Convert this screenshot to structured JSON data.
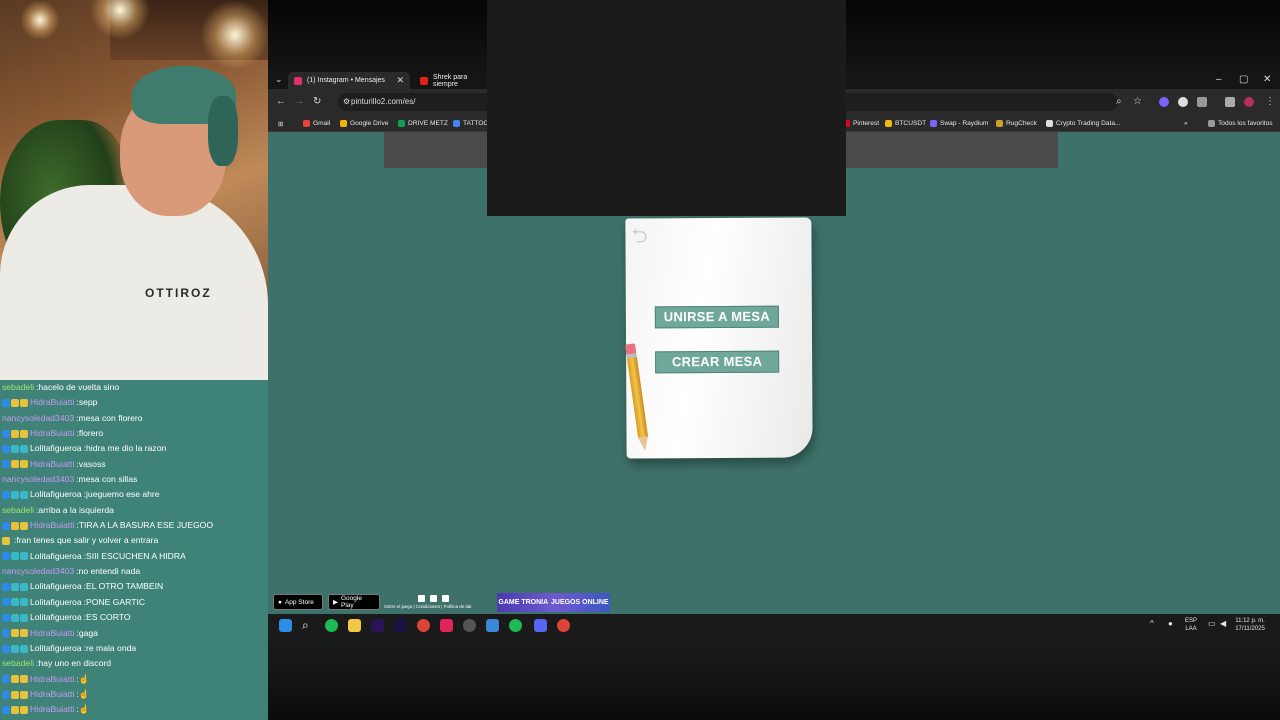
{
  "webcam": {
    "shirt_text": "OTTIROZ"
  },
  "chat": {
    "lines": [
      {
        "user": "sebadeli",
        "msg": "hacelo de vuelta sino",
        "color": "#9bea6e",
        "badges": []
      },
      {
        "user": "HidraBuiatti",
        "msg": "sepp",
        "color": "#c79af4",
        "badges": [
          "b-blue",
          "b-yellow",
          "b-yellow"
        ]
      },
      {
        "user": "nancysoledad3403",
        "msg": "mesa con florero",
        "color": "#c79af4",
        "badges": []
      },
      {
        "user": "HidraBuiatti",
        "msg": "florero",
        "color": "#c79af4",
        "badges": [
          "b-blue",
          "b-yellow",
          "b-yellow"
        ]
      },
      {
        "user": "Lolitafigueroa",
        "msg": "hidra me dio la razon",
        "color": "#ffffff",
        "badges": [
          "b-blue",
          "b-teal",
          "b-teal"
        ]
      },
      {
        "user": "HidraBuiatti",
        "msg": "vasoss",
        "color": "#c79af4",
        "badges": [
          "b-blue",
          "b-yellow",
          "b-yellow"
        ]
      },
      {
        "user": "nancysoledad3403",
        "msg": "mesa con sillas",
        "color": "#c79af4",
        "badges": []
      },
      {
        "user": "Lolitafigueroa",
        "msg": "jueguemo ese ahre",
        "color": "#ffffff",
        "badges": [
          "b-blue",
          "b-teal",
          "b-teal"
        ]
      },
      {
        "user": "sebadeli",
        "msg": "arriba a la isquierda",
        "color": "#9bea6e",
        "badges": []
      },
      {
        "user": "HidraBuiatti",
        "msg": "TIRA A LA BASURA ESE JUEGOO",
        "color": "#c79af4",
        "badges": [
          "b-blue",
          "b-yellow",
          "b-yellow"
        ]
      },
      {
        "user": "",
        "msg": "fran tenes que salir y volver a entrara",
        "color": "#c0392b",
        "badges": [
          "b-yellow"
        ]
      },
      {
        "user": "Lolitafigueroa",
        "msg": "SIII ESCUCHEN A HIDRA",
        "color": "#ffffff",
        "badges": [
          "b-blue",
          "b-teal",
          "b-teal"
        ]
      },
      {
        "user": "nancysoledad3403",
        "msg": "no entendi nada",
        "color": "#c79af4",
        "badges": []
      },
      {
        "user": "Lolitafigueroa",
        "msg": "EL OTRO TAMBEIN",
        "color": "#ffffff",
        "badges": [
          "b-blue",
          "b-teal",
          "b-teal"
        ]
      },
      {
        "user": "Lolitafigueroa",
        "msg": "PONE GARTIC",
        "color": "#ffffff",
        "badges": [
          "b-blue",
          "b-teal",
          "b-teal"
        ]
      },
      {
        "user": "Lolitafigueroa",
        "msg": "ES CORTO",
        "color": "#ffffff",
        "badges": [
          "b-blue",
          "b-teal",
          "b-teal"
        ]
      },
      {
        "user": "HidraBuiatti",
        "msg": "gaga",
        "color": "#c79af4",
        "badges": [
          "b-blue",
          "b-yellow",
          "b-yellow"
        ]
      },
      {
        "user": "Lolitafigueroa",
        "msg": "re mala onda",
        "color": "#ffffff",
        "badges": [
          "b-blue",
          "b-teal",
          "b-teal"
        ]
      },
      {
        "user": "sebadeli",
        "msg": "hay uno en discord",
        "color": "#9bea6e",
        "badges": []
      },
      {
        "user": "HidraBuiatti",
        "msg": "☝",
        "color": "#c79af4",
        "badges": [
          "b-blue",
          "b-yellow",
          "b-yellow"
        ]
      },
      {
        "user": "HidraBuiatti",
        "msg": "☝",
        "color": "#c79af4",
        "badges": [
          "b-blue",
          "b-yellow",
          "b-yellow"
        ]
      },
      {
        "user": "HidraBuiatti",
        "msg": "☝",
        "color": "#c79af4",
        "badges": [
          "b-blue",
          "b-yellow",
          "b-yellow"
        ]
      }
    ]
  },
  "browser": {
    "tabs": [
      {
        "label": "(1) Instagram • Mensajes",
        "fav_color": "#e1306c"
      },
      {
        "label": "Shrek para siempre",
        "fav_color": "#e62117"
      }
    ],
    "url": "pinturillo2.com/es/",
    "bookmarks": [
      {
        "label": "Gmail",
        "color": "#ea4335"
      },
      {
        "label": "Google Drive",
        "color": "#f4b400"
      },
      {
        "label": "DRIVE METZ",
        "color": "#0f9d58"
      },
      {
        "label": "TATTOO",
        "color": "#4285f4"
      },
      {
        "label": "Pinterest",
        "color": "#e60023"
      },
      {
        "label": "BTCUSDT",
        "color": "#f0b90b"
      },
      {
        "label": "Swap - Raydium",
        "color": "#7b61ff"
      },
      {
        "label": "RugCheck",
        "color": "#c9a227"
      },
      {
        "label": "Crypto Trading Data...",
        "color": "#dddddd"
      }
    ],
    "all_bookmarks": "Todos los favoritos"
  },
  "game": {
    "join_label": "UNIRSE A MESA",
    "create_label": "CREAR MESA"
  },
  "footer": {
    "appstore": "App Store",
    "googleplay": "Google Play",
    "links": "Sobre el juego | Condiciones | Política de dat",
    "banner_left": "GAME TRONIA",
    "banner_right": "JUEGOS ONLINE"
  },
  "taskbar": {
    "lang_top": "ESP",
    "lang_bottom": "LAA",
    "time": "11:12 p. m.",
    "date": "17/11/2025"
  }
}
